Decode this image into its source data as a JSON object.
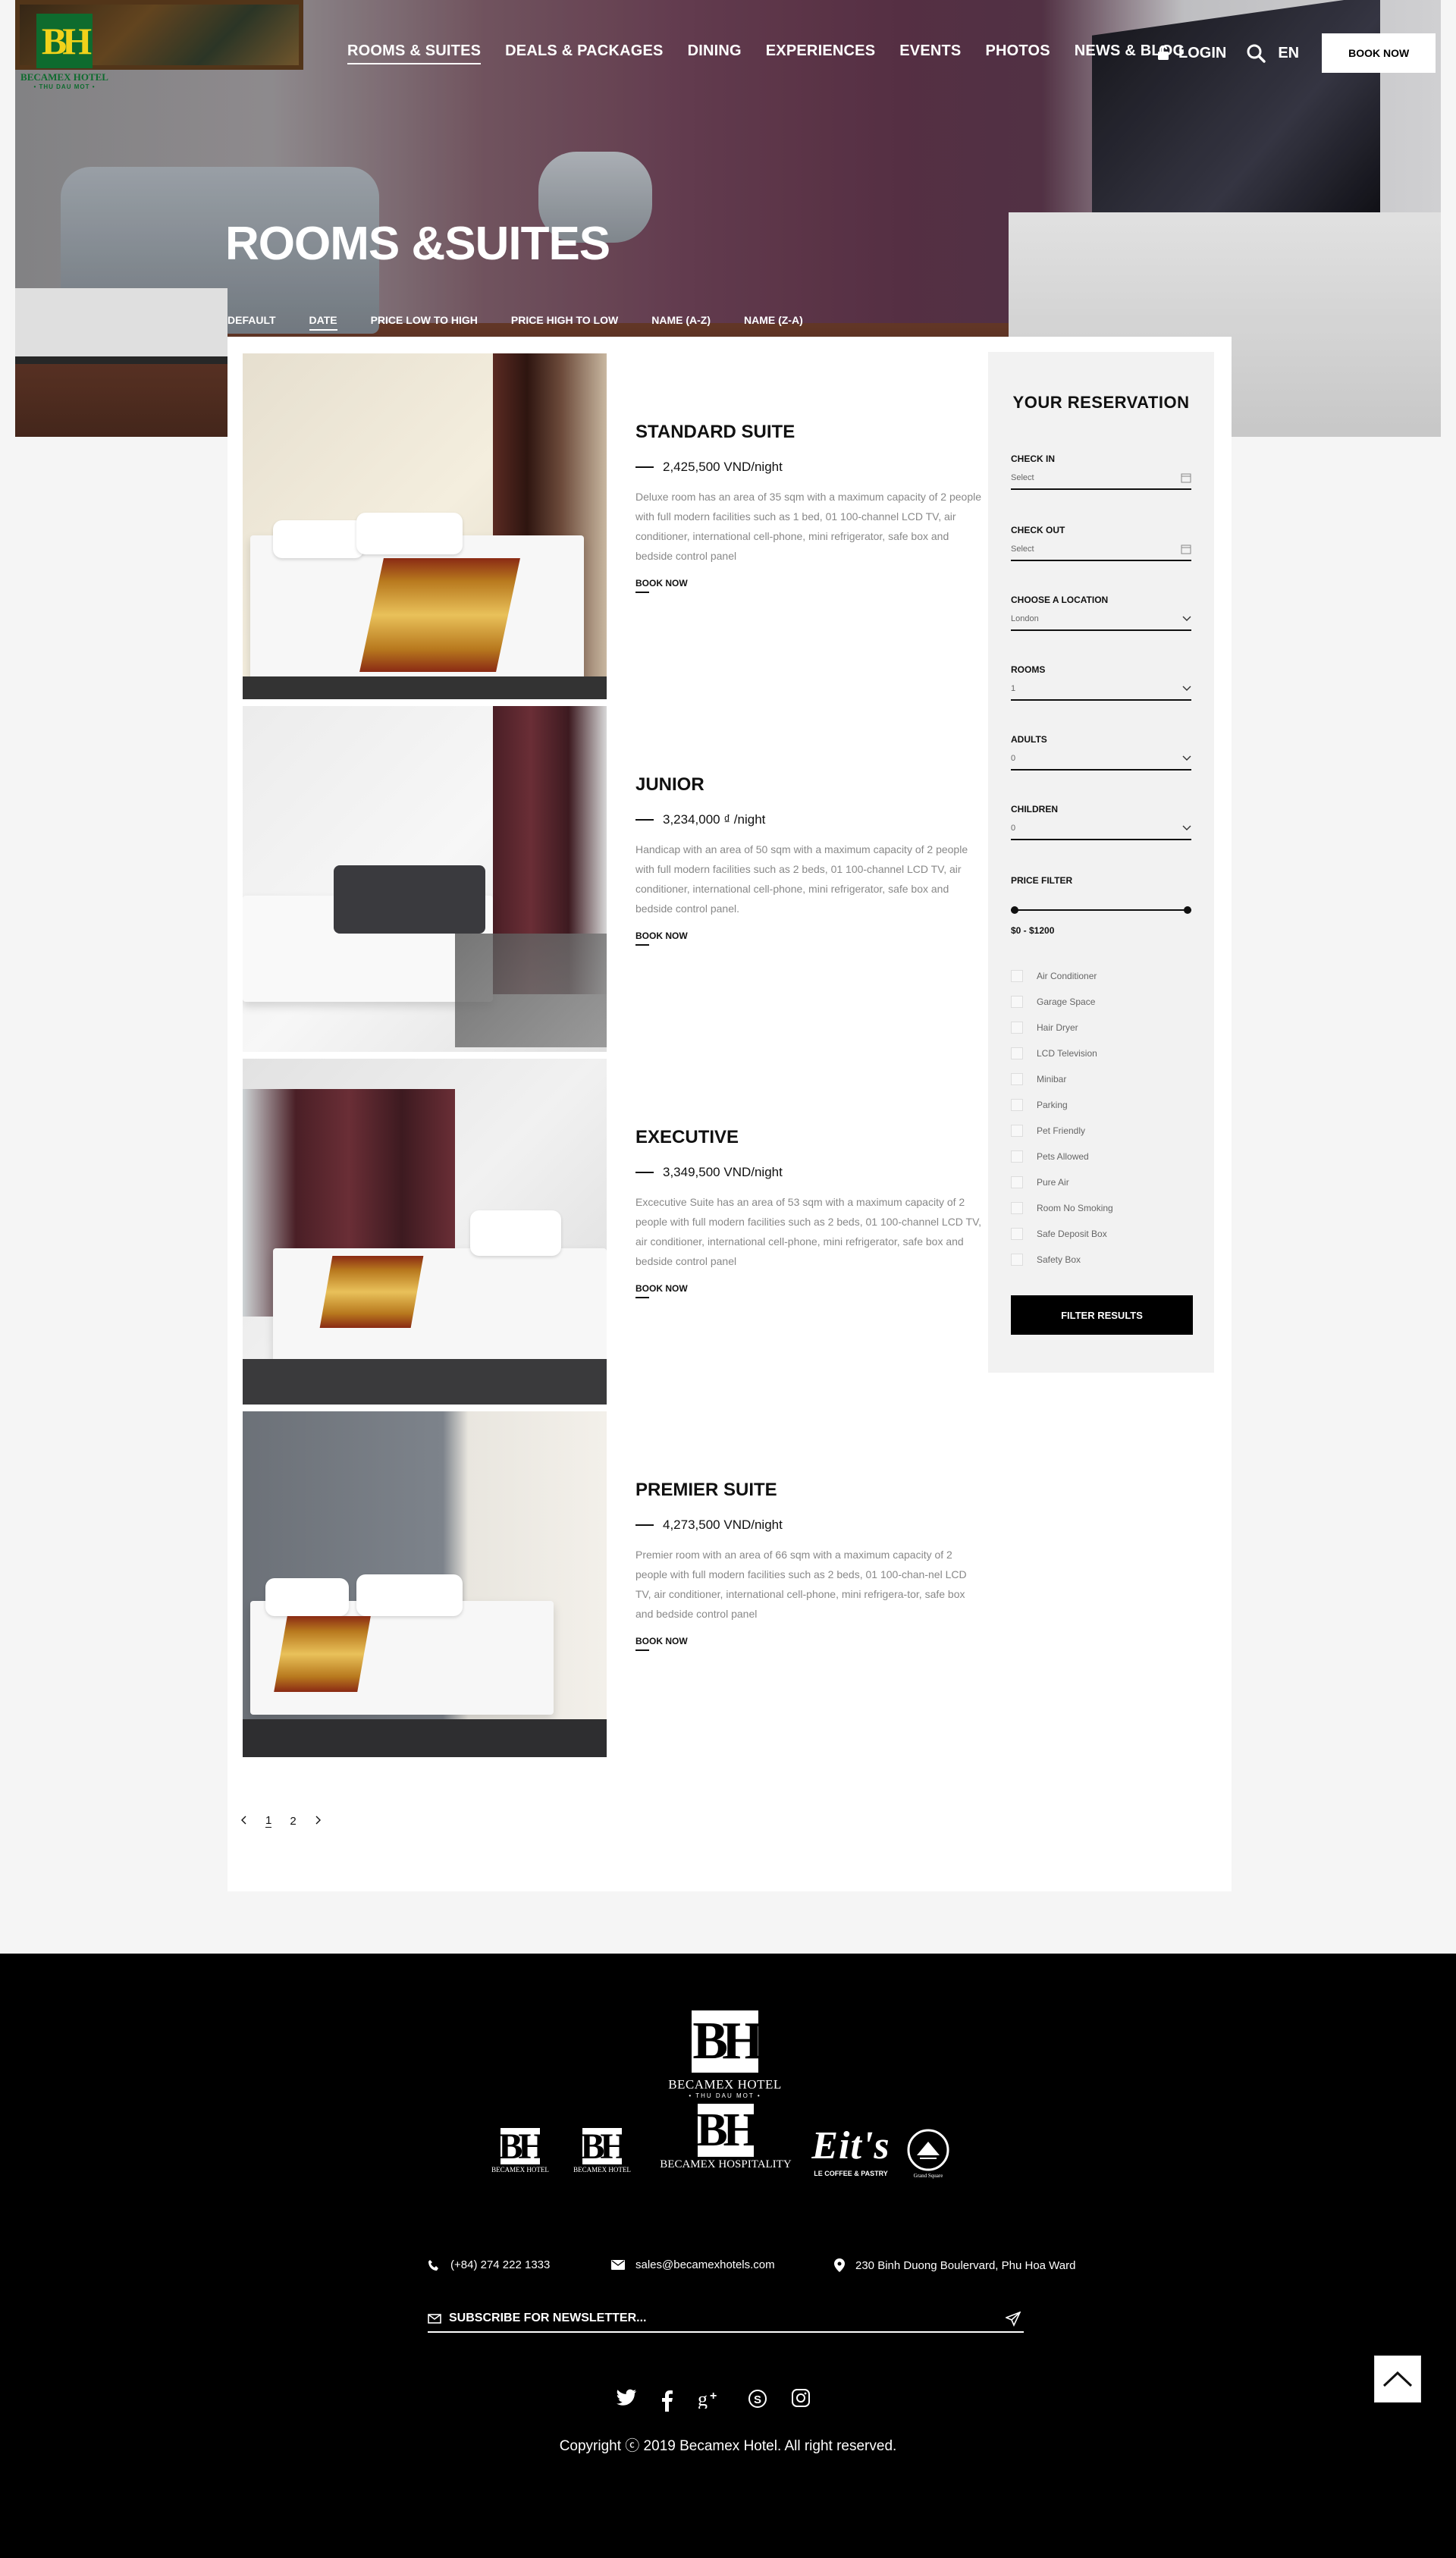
{
  "brand": {
    "logo_text": "BH",
    "name": "BECAMEX HOTEL",
    "tagline": "• THU DAU MOT •"
  },
  "nav": [
    {
      "label": "ROOMS & SUITES"
    },
    {
      "label": "DEALS & PACKAGES"
    },
    {
      "label": "DINING"
    },
    {
      "label": "EXPERIENCES"
    },
    {
      "label": "EVENTS"
    },
    {
      "label": "PHOTOS"
    },
    {
      "label": "NEWS & BLOG"
    }
  ],
  "header": {
    "login": "LOGIN",
    "lang": "EN",
    "book_now": "BOOK NOW"
  },
  "hero": {
    "title": "ROOMS &SUITES"
  },
  "sort": [
    "DEFAULT",
    "DATE",
    "PRICE LOW TO HIGH",
    "PRICE HIGH TO LOW",
    "NAME (A-Z)",
    "NAME (Z-A)"
  ],
  "rooms": [
    {
      "name": "STANDARD SUITE",
      "price": "2,425,500 VND/night",
      "desc": "Deluxe room has an area of 35 sqm with a maximum capacity of 2 people with full modern facilities such as 1 bed, 01 100-channel LCD TV, air conditioner, international cell-phone, mini refrigerator, safe box and bedside control panel",
      "cta": "BOOK NOW"
    },
    {
      "name": "JUNIOR",
      "price": "3,234,000 ₫ /night",
      "desc": "Handicap with an area of 50 sqm with a maximum capacity of 2 people with full modern facilities such as 2 beds, 01 100-channel LCD TV, air conditioner, international cell-phone, mini refrigerator, safe box and bedside control panel.",
      "cta": "BOOK NOW"
    },
    {
      "name": "EXECUTIVE",
      "price": "3,349,500 VND/night",
      "desc": "Excecutive Suite has an area of 53 sqm with a maximum capacity of 2 people with full modern facilities such as 2 beds, 01 100-channel LCD TV, air conditioner, international cell-phone, mini refrigerator, safe box and bedside control panel",
      "cta": "BOOK NOW"
    },
    {
      "name": "PREMIER SUITE",
      "price": "4,273,500 VND/night",
      "desc": "Premier room with an area of 66 sqm with a maximum capacity of 2 people with full modern facilities such as 2 beds, 01 100-chan-nel LCD TV, air conditioner, international cell-phone, mini refrigera-tor, safe box and bedside control panel",
      "cta": "BOOK NOW"
    }
  ],
  "reservation": {
    "title": "YOUR RESERVATION",
    "check_in": {
      "label": "CHECK IN",
      "value": "Select"
    },
    "check_out": {
      "label": "CHECK OUT",
      "value": "Select"
    },
    "location": {
      "label": "CHOOSE A LOCATION",
      "value": "London"
    },
    "rooms": {
      "label": "ROOMS",
      "value": "1"
    },
    "adults": {
      "label": "ADULTS",
      "value": "0"
    },
    "children": {
      "label": "CHILDREN",
      "value": "0"
    },
    "price_filter": {
      "label": "PRICE FILTER",
      "range": "$0 - $1200",
      "min": 0,
      "max": 1200
    },
    "amenities": [
      "Air Conditioner",
      "Garage Space",
      "Hair Dryer",
      "LCD Television",
      "Minibar",
      "Parking",
      "Pet Friendly",
      "Pets Allowed",
      "Pure Air",
      "Room No Smoking",
      "Safe Deposit Box",
      "Safety Box"
    ],
    "filter_button": "FILTER RESULTS"
  },
  "pagination": {
    "pages": [
      "1",
      "2"
    ],
    "current": "1"
  },
  "footer": {
    "logo_text": "BH",
    "name": "BECAMEX HOTEL",
    "tagline": "• THU DAU MOT •",
    "brands": [
      {
        "logo": "BH",
        "name": "BECAMEX HOTEL"
      },
      {
        "logo": "BH",
        "name": "BECAMEX HOTEL"
      },
      {
        "logo": "BH",
        "name": "BECAMEX HOSPITALITY"
      },
      {
        "logo": "Eit's",
        "name": "LE COFFEE & PASTRY"
      },
      {
        "logo": "",
        "name": "Grand Square"
      }
    ],
    "phone": "(+84) 274 222 1333",
    "email": "sales@becamexhotels.com",
    "address": "230 Binh Duong Boulervard, Phu Hoa Ward",
    "newsletter": "SUBSCRIBE FOR NEWSLETTER...",
    "copyright": "Copyright ⓒ 2019 Becamex Hotel. All right reserved."
  }
}
